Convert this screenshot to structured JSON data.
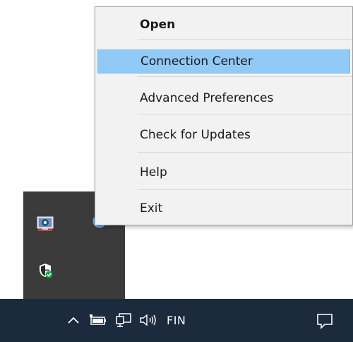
{
  "context_menu": {
    "items": [
      {
        "label": "Open",
        "bold": true
      },
      {
        "label": "Connection Center",
        "highlighted": true
      },
      {
        "label": "Advanced Preferences"
      },
      {
        "label": "Check for Updates"
      },
      {
        "label": "Help"
      },
      {
        "label": "Exit"
      }
    ]
  },
  "tray_flyout": {
    "icons": [
      "citrix-workspace-icon",
      "windows-security-icon",
      "partial-blue-icon"
    ]
  },
  "taskbar": {
    "language": "FIN",
    "icons": [
      "chevron-up-icon",
      "battery-icon",
      "network-icon",
      "volume-icon",
      "notification-icon"
    ]
  },
  "colors": {
    "menu_background": "#f2f2f2",
    "menu_highlight": "#91c9f7",
    "taskbar": "#1c2a3d",
    "flyout": "#3b3b3b"
  }
}
